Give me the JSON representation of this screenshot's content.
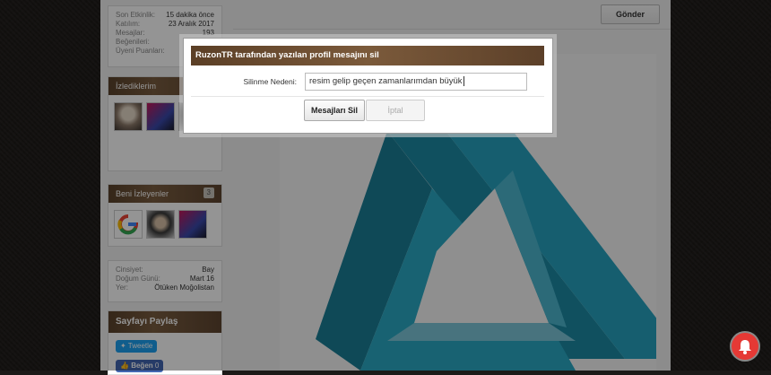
{
  "sidebar": {
    "stats": [
      {
        "key": "Son Etkinlik:",
        "value": "15 dakika önce"
      },
      {
        "key": "Katılım:",
        "value": "23 Aralık 2017"
      },
      {
        "key": "Mesajlar:",
        "value": "193"
      },
      {
        "key": "Beğenileri:",
        "value": ""
      },
      {
        "key": "Üyeni Puanları:",
        "value": ""
      }
    ],
    "following": {
      "title": "İzlediklerim"
    },
    "followers": {
      "title": "Beni İzleyenler",
      "count": "3"
    },
    "info": [
      {
        "key": "Cinsiyet:",
        "value": "Bay"
      },
      {
        "key": "Doğum Günü:",
        "value": "Mart 16"
      },
      {
        "key": "Yer:",
        "value": "Ötüken Moğolistan"
      }
    ],
    "share": {
      "title": "Sayfayı Paylaş",
      "tweet_label": "Tweetle",
      "like_label": "Beğen",
      "like_count": "0"
    }
  },
  "main": {
    "send_label": "Gönder"
  },
  "dialog": {
    "title": "RuzonTR tarafından yazılan profil mesajını sil",
    "reason_label": "Silinme Nedeni:",
    "reason_value": "resim gelip geçen zamanlarımdan büyük",
    "delete_label": "Mesajları Sil",
    "cancel_label": "İptal"
  },
  "colors": {
    "accent_brown": "#6a4e33",
    "triangle": "#1e90a8",
    "bell": "#e53935"
  }
}
